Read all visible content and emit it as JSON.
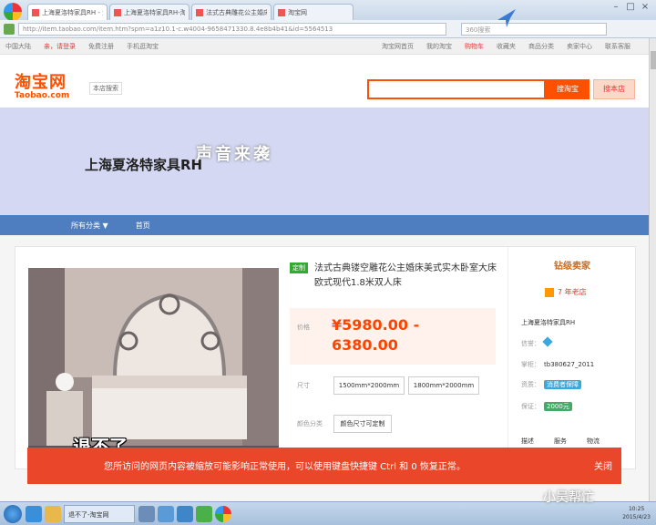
{
  "browser": {
    "tabs": [
      {
        "label": "上海夏洛特家具RH - 淘宝网"
      },
      {
        "label": "上海夏洛特家具RH-淘宝网"
      },
      {
        "label": "法式古典雕花公主婚床"
      },
      {
        "label": "淘宝网"
      }
    ],
    "url": "http://item.taobao.com/item.htm?spm=a1z10.1-c.w4004-9658471330.8.4e8b4b41&id=5564513",
    "search_placeholder": "360搜索"
  },
  "sitenav": {
    "left": [
      "中国大陆",
      "亲，请登录",
      "免费注册",
      "手机逛淘宝"
    ],
    "right": [
      "淘宝网首页",
      "我的淘宝",
      "购物车",
      "收藏夹",
      "商品分类",
      "卖家中心",
      "联系客服"
    ]
  },
  "header": {
    "logo_cn": "淘宝网",
    "logo_en": "Taobao.com",
    "shop_btn": "本店搜索",
    "search_btn": "搜淘宝",
    "search_btn2": "搜本店"
  },
  "banner": {
    "title": "上海夏洛特家具RH"
  },
  "navbar": {
    "items": [
      "所有分类 ▼",
      "首页"
    ]
  },
  "product": {
    "tag": "定制",
    "title": "法式古典镂空雕花公主婚床美式实木卧室大床欧式现代1.8米双人床",
    "price_label": "价格",
    "price": "¥5980.00 - 6380.00",
    "size_label": "尺寸",
    "size_options": [
      "1500mm*2000mm",
      "1800mm*2000mm"
    ],
    "color_label": "颜色分类",
    "color_option": "颜色尺寸可定制"
  },
  "subtitles": {
    "line1": "声音来袭",
    "line2": "退不了"
  },
  "seller": {
    "title": "钻级卖家",
    "years": "7 年老店",
    "name": "上海夏洛特家具RH",
    "credit_label": "信誉：",
    "contact_label": "掌柜：",
    "contact_value": "tb380627_2011",
    "pay_label": "资质：",
    "pay_badge": "消费者保障",
    "qual_label": "保证：",
    "qual_badge": "2000元",
    "metrics": [
      "描述",
      "服务",
      "物流"
    ]
  },
  "notice": {
    "text": "您所访问的网页内容被缩放可能影响正常使用，可以使用键盘快捷键 Ctrl 和 0 恢复正常。",
    "close": "关闭"
  },
  "taskbar": {
    "task_label": "退不了-淘宝网",
    "watermark": "小吴帮忙",
    "time": "10:25",
    "date": "2015/4/23"
  }
}
